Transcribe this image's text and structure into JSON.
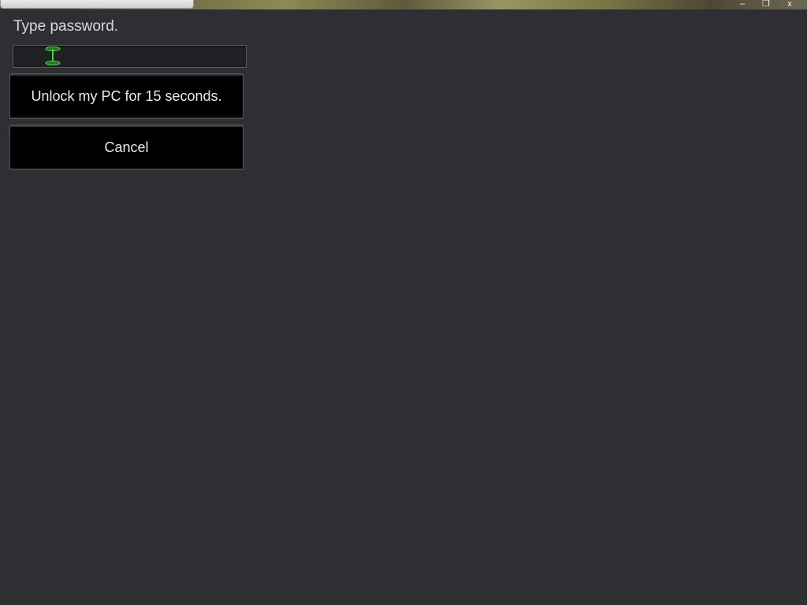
{
  "background": {
    "window_controls": {
      "minimize_icon": "minimize-icon",
      "restore_icon": "restore-icon",
      "close_glyph": "x"
    }
  },
  "dialog": {
    "prompt": "Type password.",
    "password_value": "",
    "unlock_label": "Unlock my PC for 15 seconds.",
    "cancel_label": "Cancel"
  },
  "colors": {
    "background": "#2e2f32",
    "button_bg": "#000000",
    "text": "#eaeaea",
    "caret": "#3bd23b"
  }
}
